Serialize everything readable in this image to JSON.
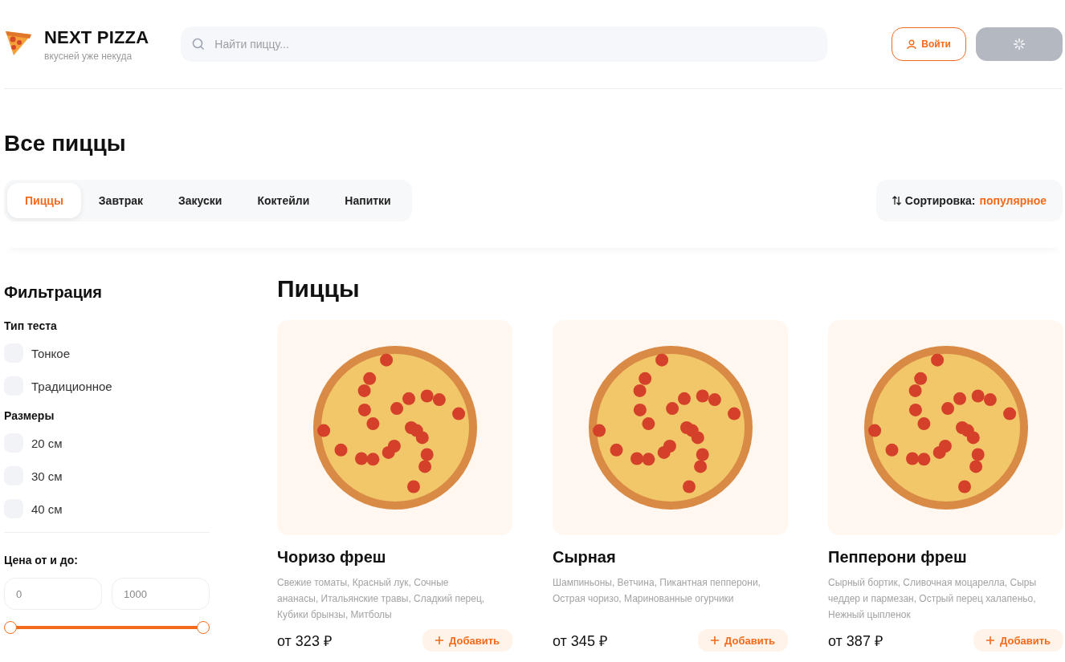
{
  "header": {
    "logo_title": "NEXT PIZZA",
    "logo_subtitle": "вкусней уже некуда",
    "search": {
      "placeholder": "Найти пиццу..."
    },
    "login_button": "Войти",
    "cart_button": {
      "loading": true
    }
  },
  "page_title": "Все пиццы",
  "categories": [
    {
      "label": "Пиццы",
      "selected": true
    },
    {
      "label": "Завтрак",
      "selected": false
    },
    {
      "label": "Закуски",
      "selected": false
    },
    {
      "label": "Коктейли",
      "selected": false
    },
    {
      "label": "Напитки",
      "selected": false
    }
  ],
  "sort": {
    "label": "Сортировка:",
    "value": "популярное"
  },
  "filters": {
    "title": "Фильтрация",
    "groups": [
      {
        "title": "Тип теста",
        "options": [
          {
            "label": "Тонкое",
            "checked": false
          },
          {
            "label": "Традиционное",
            "checked": false
          }
        ]
      },
      {
        "title": "Размеры",
        "options": [
          {
            "label": "20 см",
            "checked": false
          },
          {
            "label": "30 см",
            "checked": false
          },
          {
            "label": "40 см",
            "checked": false
          }
        ]
      }
    ],
    "price": {
      "title": "Цена от и до:",
      "from": {
        "placeholder": "0"
      },
      "to": {
        "placeholder": "1000"
      },
      "slider": {
        "level": 1
      }
    }
  },
  "section_title": "Пиццы",
  "products": [
    {
      "name": "Чоризо фреш",
      "description": "Свежие томаты, Красный лук, Сочные ананасы, Итальянские травы, Сладкий перец, Кубики брынзы, Митболы",
      "price": "от 323 ₽",
      "button": "Добавить"
    },
    {
      "name": "Сырная",
      "description": "Шампиньоны, Ветчина, Пикантная пепперони, Острая чоризо, Маринованные огурчики",
      "price": "от 345 ₽",
      "button": "Добавить"
    },
    {
      "name": "Пепперони фреш",
      "description": "Сырный бортик, Сливочная моцарелла, Сыры чеддер и пармезан, Острый перец халапеньо, Нежный цыпленок",
      "price": "от 387 ₽",
      "button": "Добавить"
    }
  ]
}
